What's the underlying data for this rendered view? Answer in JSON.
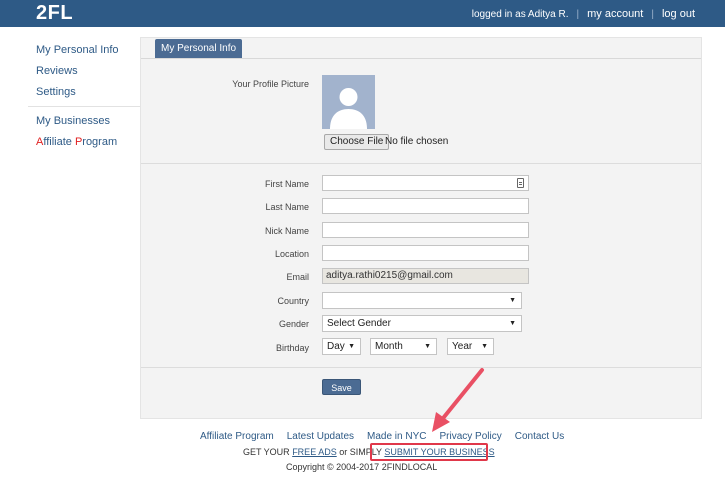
{
  "header": {
    "logo": "2FL",
    "logged_in_text": "logged in as Aditya R.",
    "my_account": "my account",
    "logout": "log out"
  },
  "sidebar": {
    "items": [
      {
        "label": "My Personal Info"
      },
      {
        "label": "Reviews"
      },
      {
        "label": "Settings"
      },
      {
        "label": "My Businesses"
      }
    ],
    "affiliate": {
      "a": "A",
      "rest1": "ffiliate ",
      "p": "P",
      "rest2": "rogram"
    }
  },
  "main": {
    "tab_label": "My Personal Info",
    "profile_picture_label": "Your Profile Picture",
    "choose_file": "Choose File",
    "no_file": "No file chosen",
    "fields": {
      "first_name": {
        "label": "First Name",
        "value": ""
      },
      "last_name": {
        "label": "Last Name",
        "value": ""
      },
      "nick_name": {
        "label": "Nick Name",
        "value": ""
      },
      "location": {
        "label": "Location",
        "value": ""
      },
      "email": {
        "label": "Email",
        "value": "aditya.rathi0215@gmail.com"
      }
    },
    "country": {
      "label": "Country",
      "value": ""
    },
    "gender": {
      "label": "Gender",
      "value": "Select Gender"
    },
    "birthday": {
      "label": "Birthday",
      "day": "Day",
      "month": "Month",
      "year": "Year"
    },
    "save": "Save"
  },
  "footer": {
    "links": [
      "Affiliate Program",
      "Latest Updates",
      "Made in NYC",
      "Privacy Policy",
      "Contact Us"
    ],
    "get_your": "GET YOUR ",
    "free_ads": "FREE ADS",
    "or_simply": " or SIMPLY ",
    "submit": "SUBMIT YOUR BUSINESS",
    "copyright": "Copyright © 2004-2017 2FINDLOCAL"
  },
  "colors": {
    "topbar": "#2e5a86",
    "tab": "#4b6b93",
    "annotation": "#e0384a"
  }
}
